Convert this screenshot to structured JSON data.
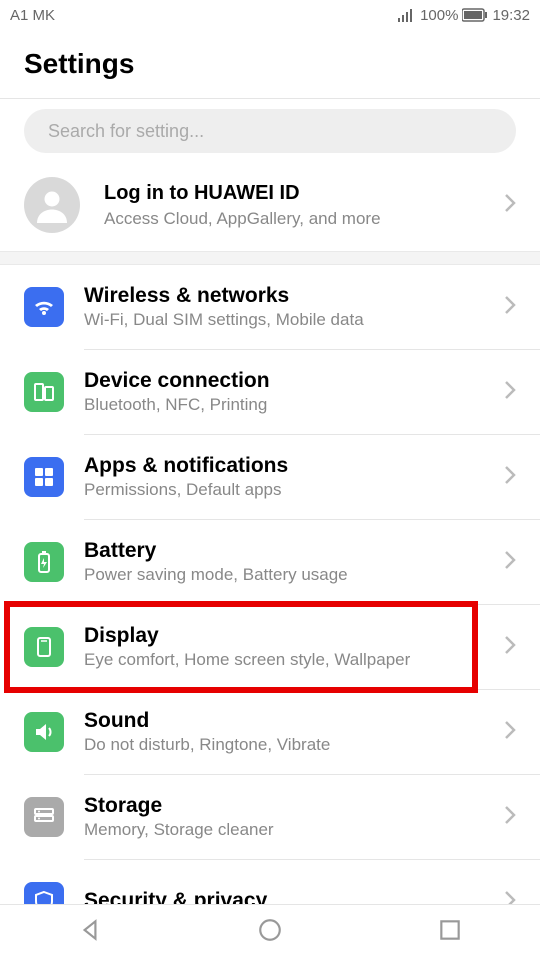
{
  "status": {
    "carrier": "A1 MK",
    "battery": "100%",
    "time": "19:32"
  },
  "header": {
    "title": "Settings"
  },
  "search": {
    "placeholder": "Search for setting..."
  },
  "account": {
    "title": "Log in to HUAWEI ID",
    "subtitle": "Access Cloud, AppGallery, and more"
  },
  "items": [
    {
      "title": "Wireless & networks",
      "subtitle": "Wi-Fi, Dual SIM settings, Mobile data",
      "color": "blue",
      "icon": "wifi"
    },
    {
      "title": "Device connection",
      "subtitle": "Bluetooth, NFC, Printing",
      "color": "green",
      "icon": "device"
    },
    {
      "title": "Apps & notifications",
      "subtitle": "Permissions, Default apps",
      "color": "blue",
      "icon": "apps"
    },
    {
      "title": "Battery",
      "subtitle": "Power saving mode, Battery usage",
      "color": "green",
      "icon": "battery"
    },
    {
      "title": "Display",
      "subtitle": "Eye comfort, Home screen style, Wallpaper",
      "color": "green",
      "icon": "display",
      "highlight": true
    },
    {
      "title": "Sound",
      "subtitle": "Do not disturb, Ringtone, Vibrate",
      "color": "green",
      "icon": "sound"
    },
    {
      "title": "Storage",
      "subtitle": "Memory, Storage cleaner",
      "color": "grey",
      "icon": "storage"
    },
    {
      "title": "Security & privacy",
      "subtitle": "",
      "color": "blue",
      "icon": "security"
    }
  ]
}
